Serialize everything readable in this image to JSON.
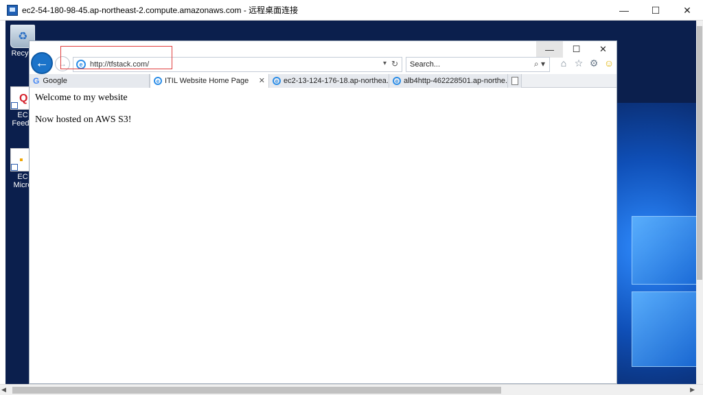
{
  "rdp": {
    "title": "ec2-54-180-98-45.ap-northeast-2.compute.amazonaws.com - 远程桌面连接",
    "minimize": "—",
    "maximize": "☐",
    "close": "✕"
  },
  "desktop": {
    "icons": [
      {
        "label": "Recycl"
      },
      {
        "label": "EC\nFeedb",
        "badge": "Q"
      },
      {
        "label": "EC\nMicro",
        "badge": "▪"
      }
    ]
  },
  "browser": {
    "window_controls": {
      "minimize": "—",
      "maximize": "☐",
      "close": "✕"
    },
    "back": "←",
    "forward": "→",
    "address": "http://tfstack.com/",
    "address_dropdown": "▾",
    "refresh": "↻",
    "search_placeholder": "Search...",
    "search_button": "⌕ ▾",
    "tools": {
      "home": "⌂",
      "favorites": "☆",
      "settings": "⚙",
      "feedback": "☺"
    },
    "tabs": [
      {
        "label": "Google"
      },
      {
        "label": "ITIL Website Home Page",
        "close": "✕"
      },
      {
        "label": "ec2-13-124-176-18.ap-northea..."
      },
      {
        "label": "alb4http-462228501.ap-northe..."
      }
    ]
  },
  "page": {
    "line1": "Welcome to my website",
    "line2": "Now hosted on AWS S3!"
  },
  "colors": {
    "accent": "#1b73c9",
    "highlight": "#e03b3b",
    "desktop_bg": "#0b1f4d"
  }
}
